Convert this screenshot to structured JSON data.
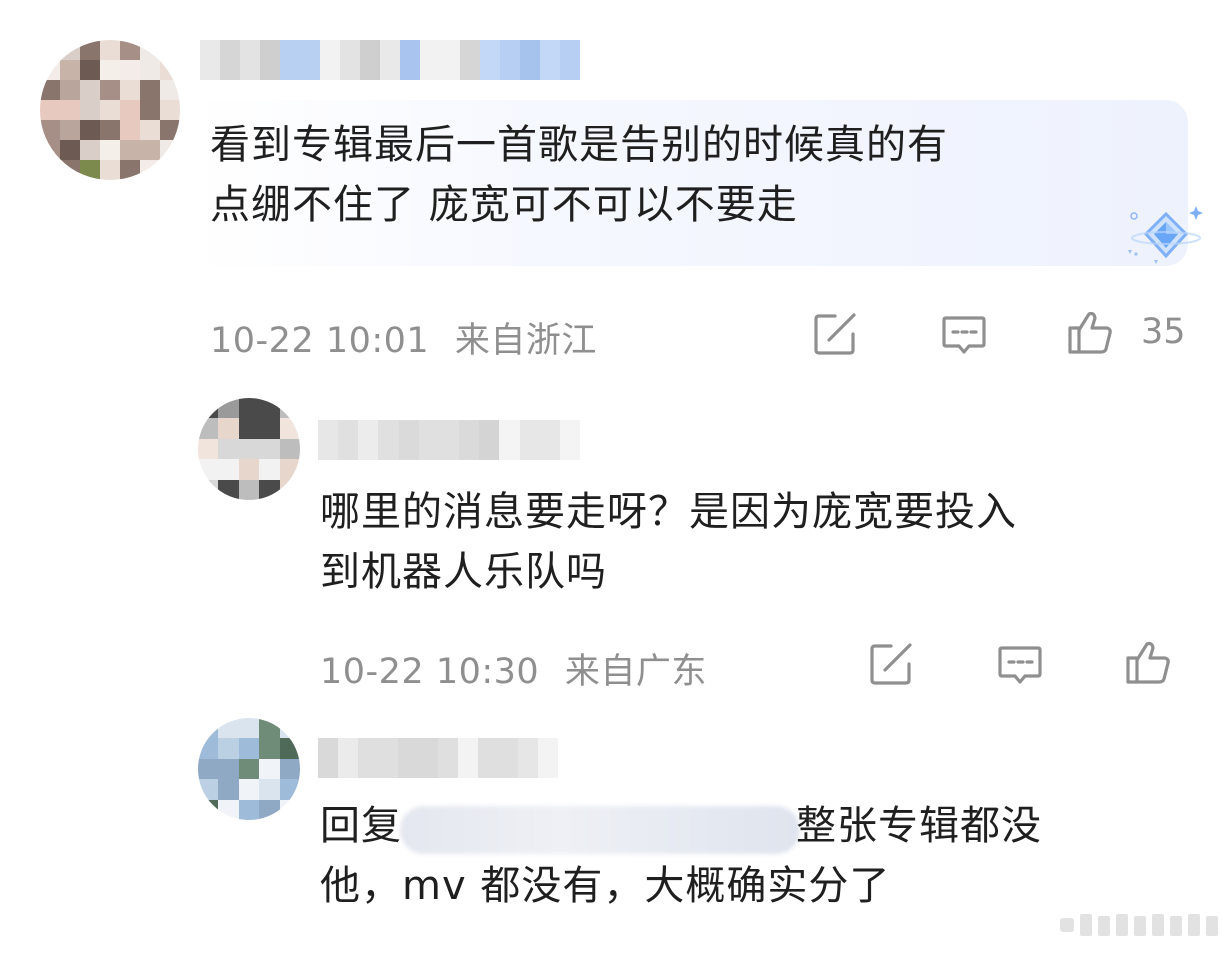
{
  "main_comment": {
    "text_line1": "看到专辑最后一首歌是告别的时候真的有",
    "text_line2": "点绷不住了 庞宽可不可以不要走",
    "time": "10-22 10:01",
    "location": "来自浙江",
    "like_count": "35",
    "icons": [
      "share-icon",
      "comment-icon",
      "like-icon"
    ]
  },
  "reply_1": {
    "text_line1": "哪里的消息要走呀？是因为庞宽要投入",
    "text_line2": "到机器人乐队吗",
    "time": "10-22 10:30",
    "location": "来自广东",
    "icons": [
      "share-icon",
      "comment-icon",
      "like-icon"
    ]
  },
  "reply_2": {
    "prefix": "回复",
    "text_line1_rest": "整张专辑都没",
    "text_line2": "他，mv 都没有，大概确实分了"
  },
  "colors": {
    "meta_gray": "#8f8f8f",
    "bubble_tint": "#eef2fd",
    "badge_blue": "#5b9cf6"
  }
}
